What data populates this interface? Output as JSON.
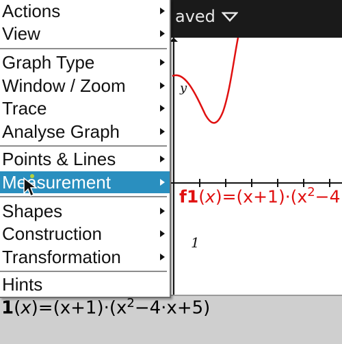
{
  "title_bar": {
    "text": "aved"
  },
  "graph": {
    "y_axis_label": "y",
    "x_tick_label": "1",
    "function_label": {
      "name": "f1",
      "var": "x",
      "expr_start": "(x+1)·(x",
      "exponent": "2",
      "expr_end": "−4"
    },
    "curve_color": "#e01010"
  },
  "entry_line": {
    "prefix": "1",
    "var": "x",
    "expr_start": "=(x+1)·(x",
    "exponent": "2",
    "expr_end": "−4·x+5)"
  },
  "menu": {
    "items": [
      {
        "label": "Actions",
        "has_submenu": true,
        "highlighted": false
      },
      {
        "label": "View",
        "has_submenu": true,
        "highlighted": false
      },
      {
        "label": "Graph Type",
        "has_submenu": true,
        "highlighted": false
      },
      {
        "label": "Window / Zoom",
        "has_submenu": true,
        "highlighted": false
      },
      {
        "label": "Trace",
        "has_submenu": true,
        "highlighted": false
      },
      {
        "label": "Analyse Graph",
        "has_submenu": true,
        "highlighted": false
      },
      {
        "label": "Points & Lines",
        "has_submenu": true,
        "highlighted": false
      },
      {
        "label": "Measurement",
        "has_submenu": true,
        "highlighted": true
      },
      {
        "label": "Shapes",
        "has_submenu": true,
        "highlighted": false
      },
      {
        "label": "Construction",
        "has_submenu": true,
        "highlighted": false
      },
      {
        "label": "Transformation",
        "has_submenu": true,
        "highlighted": false
      },
      {
        "label": "Hints",
        "has_submenu": false,
        "highlighted": false
      }
    ],
    "highlight_color": "#2a8fbf"
  },
  "icons": {
    "dropdown": "dropdown-triangle-icon",
    "cursor": "mouse-pointer-icon",
    "submenu": "chevron-right-icon"
  }
}
